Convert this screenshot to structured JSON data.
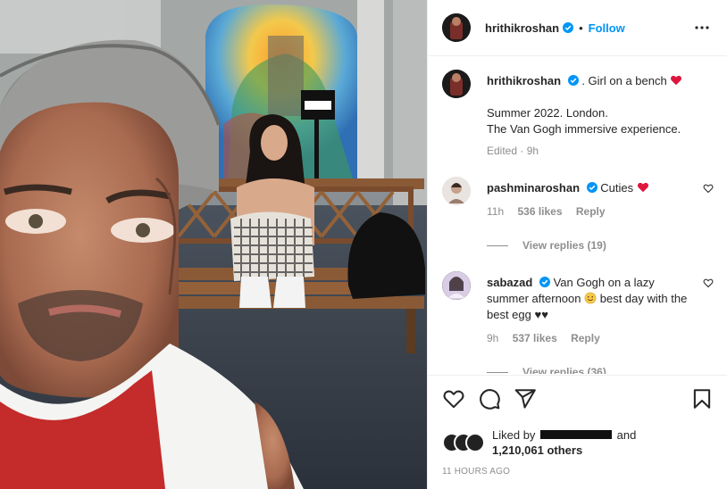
{
  "post": {
    "author": "hrithikroshan",
    "follow_label": "Follow",
    "dot": "•"
  },
  "caption": {
    "author": "hrithikroshan",
    "text_line1": ". Girl on a bench",
    "text_line2": "Summer 2022. London.",
    "text_line3": "The Van Gogh immersive experience.",
    "edited": "Edited · 9h"
  },
  "comments": [
    {
      "author": "pashminaroshan",
      "text": "Cuties",
      "time": "11h",
      "likes": "536 likes",
      "reply": "Reply",
      "view_replies": "View replies (19)"
    },
    {
      "author": "sabazad",
      "text": "Van Gogh on a lazy summer afternoon",
      "text_tail": "best day with the best egg",
      "emoji_tail": "♥♥",
      "time": "9h",
      "likes": "537 likes",
      "reply": "Reply",
      "view_replies": "View replies (36)"
    }
  ],
  "engagement": {
    "liked_by_prefix": "Liked by",
    "liked_by_and": "and",
    "others": "1,210,061 others",
    "posted_ago": "11 HOURS AGO"
  },
  "colors": {
    "link_blue": "#0095f6",
    "heart_red": "#ed4956",
    "secondary": "#8e8e8e"
  },
  "icons": [
    "heart-icon",
    "comment-icon",
    "share-icon",
    "save-icon",
    "more-icon",
    "verified-icon"
  ]
}
